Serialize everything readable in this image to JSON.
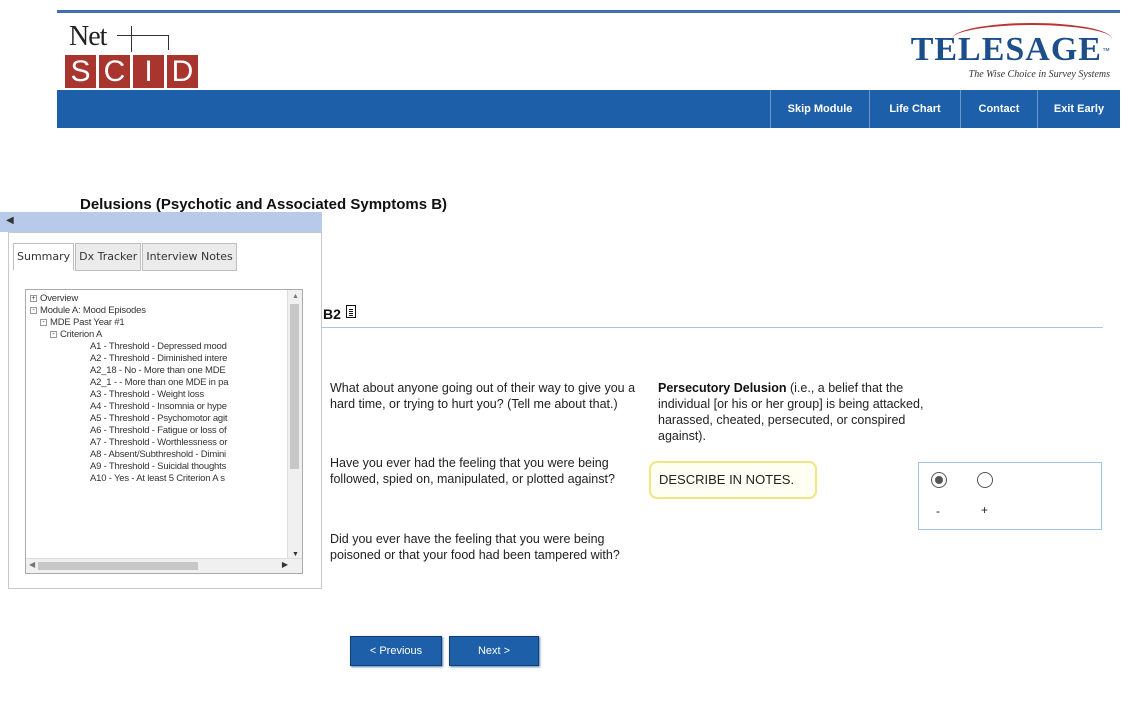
{
  "logo": {
    "net_text": "Net",
    "scid_letters": [
      "S",
      "C",
      "I",
      "D"
    ],
    "telesage_name": "TELESAGE",
    "telesage_tm": "™",
    "telesage_tagline": "The Wise Choice in Survey Systems"
  },
  "nav": {
    "items": [
      "Skip Module",
      "Life Chart",
      "Contact",
      "Exit Early"
    ]
  },
  "section_title": "Delusions (Psychotic and Associated Symptoms B)",
  "question": {
    "id": "B2",
    "texts": [
      "What about anyone going out of their way to give you a hard time, or trying to hurt you? (Tell me about that.)",
      "Have you ever had the feeling that you were being followed, spied on, manipulated, or plotted against?",
      "Did you ever have the feeling that you were being poisoned or that your food had been tampered with?"
    ],
    "criterion_bold": "Persecutory Delusion",
    "criterion_rest": " (i.e., a belief that the individual [or his or her group] is being attacked, harassed, cheated, persecuted, or conspired against).",
    "describe_label": "DESCRIBE IN NOTES.",
    "ratings": [
      {
        "label": "-",
        "selected": true
      },
      {
        "label": "+",
        "selected": false
      }
    ]
  },
  "buttons": {
    "previous": "< Previous",
    "next": "Next >"
  },
  "panel": {
    "handle_icon": "pin-arrow-icon",
    "tabs": [
      "Summary",
      "Dx Tracker",
      "Interview Notes"
    ],
    "active_tab": 0,
    "tree": [
      {
        "level": 0,
        "toggle": "+",
        "label": "Overview"
      },
      {
        "level": 0,
        "toggle": "-",
        "label": "Module A: Mood Episodes"
      },
      {
        "level": 1,
        "toggle": "-",
        "label": "MDE Past Year #1"
      },
      {
        "level": 2,
        "toggle": "-",
        "label": "Criterion A"
      },
      {
        "level": 3,
        "toggle": "",
        "label": "A1 - Threshold - Depressed mood"
      },
      {
        "level": 3,
        "toggle": "",
        "label": "A2 - Threshold - Diminished intere"
      },
      {
        "level": 3,
        "toggle": "",
        "label": "A2_18 - No - More than one MDE"
      },
      {
        "level": 3,
        "toggle": "",
        "label": "A2_1 - - More than one MDE in pa"
      },
      {
        "level": 3,
        "toggle": "",
        "label": "A3 - Threshold - Weight loss"
      },
      {
        "level": 3,
        "toggle": "",
        "label": "A4 - Threshold - Insomnia or hype"
      },
      {
        "level": 3,
        "toggle": "",
        "label": "A5 - Threshold - Psychomotor agit"
      },
      {
        "level": 3,
        "toggle": "",
        "label": "A6 - Threshold - Fatigue or loss of"
      },
      {
        "level": 3,
        "toggle": "",
        "label": "A7 - Threshold - Worthlessness or"
      },
      {
        "level": 3,
        "toggle": "",
        "label": "A8 - Absent/Subthreshold - Dimini"
      },
      {
        "level": 3,
        "toggle": "",
        "label": "A9 - Threshold - Suicidal thoughts"
      },
      {
        "level": 3,
        "toggle": "",
        "label": "A10 - Yes - At least 5 Criterion A s"
      }
    ]
  },
  "colors": {
    "nav_blue": "#1d5fa8",
    "scid_red": "#a8362f",
    "panel_handle": "#b8cae9",
    "describe_border": "#f0e682",
    "rule": "#a9c6dd"
  }
}
